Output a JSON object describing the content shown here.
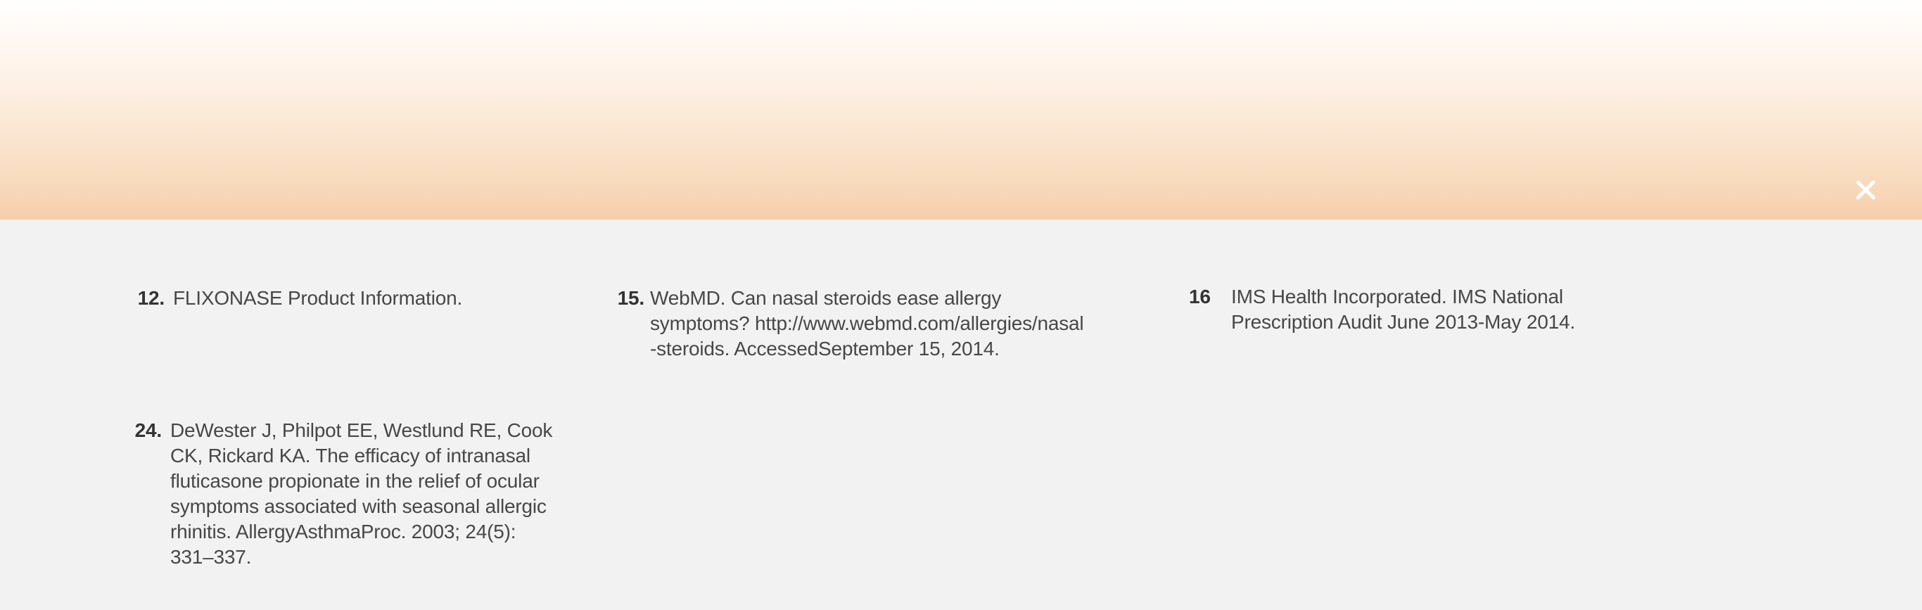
{
  "close_icon": "close-icon",
  "references": {
    "r12": {
      "num": "12.",
      "text": "FLIXONASE Product Information."
    },
    "r15": {
      "num": "15.",
      "text": "WebMD. Can nasal steroids ease allergy symptoms?",
      "url": "http://www.webmd.com/allergies/nasal-steroids.",
      "accessed": "AccessedSeptember 15, 2014."
    },
    "r16": {
      "num": "16",
      "text": "IMS Health Incorporated. IMS National Prescription Audit June 2013-May 2014."
    },
    "r24": {
      "num": "24.",
      "text": "DeWester J, Philpot EE, Westlund RE, Cook CK, Rickard KA. The efficacy of intranasal fluticasone propionate in the relief of ocular symptoms associated with seasonal allergic rhinitis. AllergyAsthmaProc. 2003; 24(5): 331–337."
    }
  }
}
